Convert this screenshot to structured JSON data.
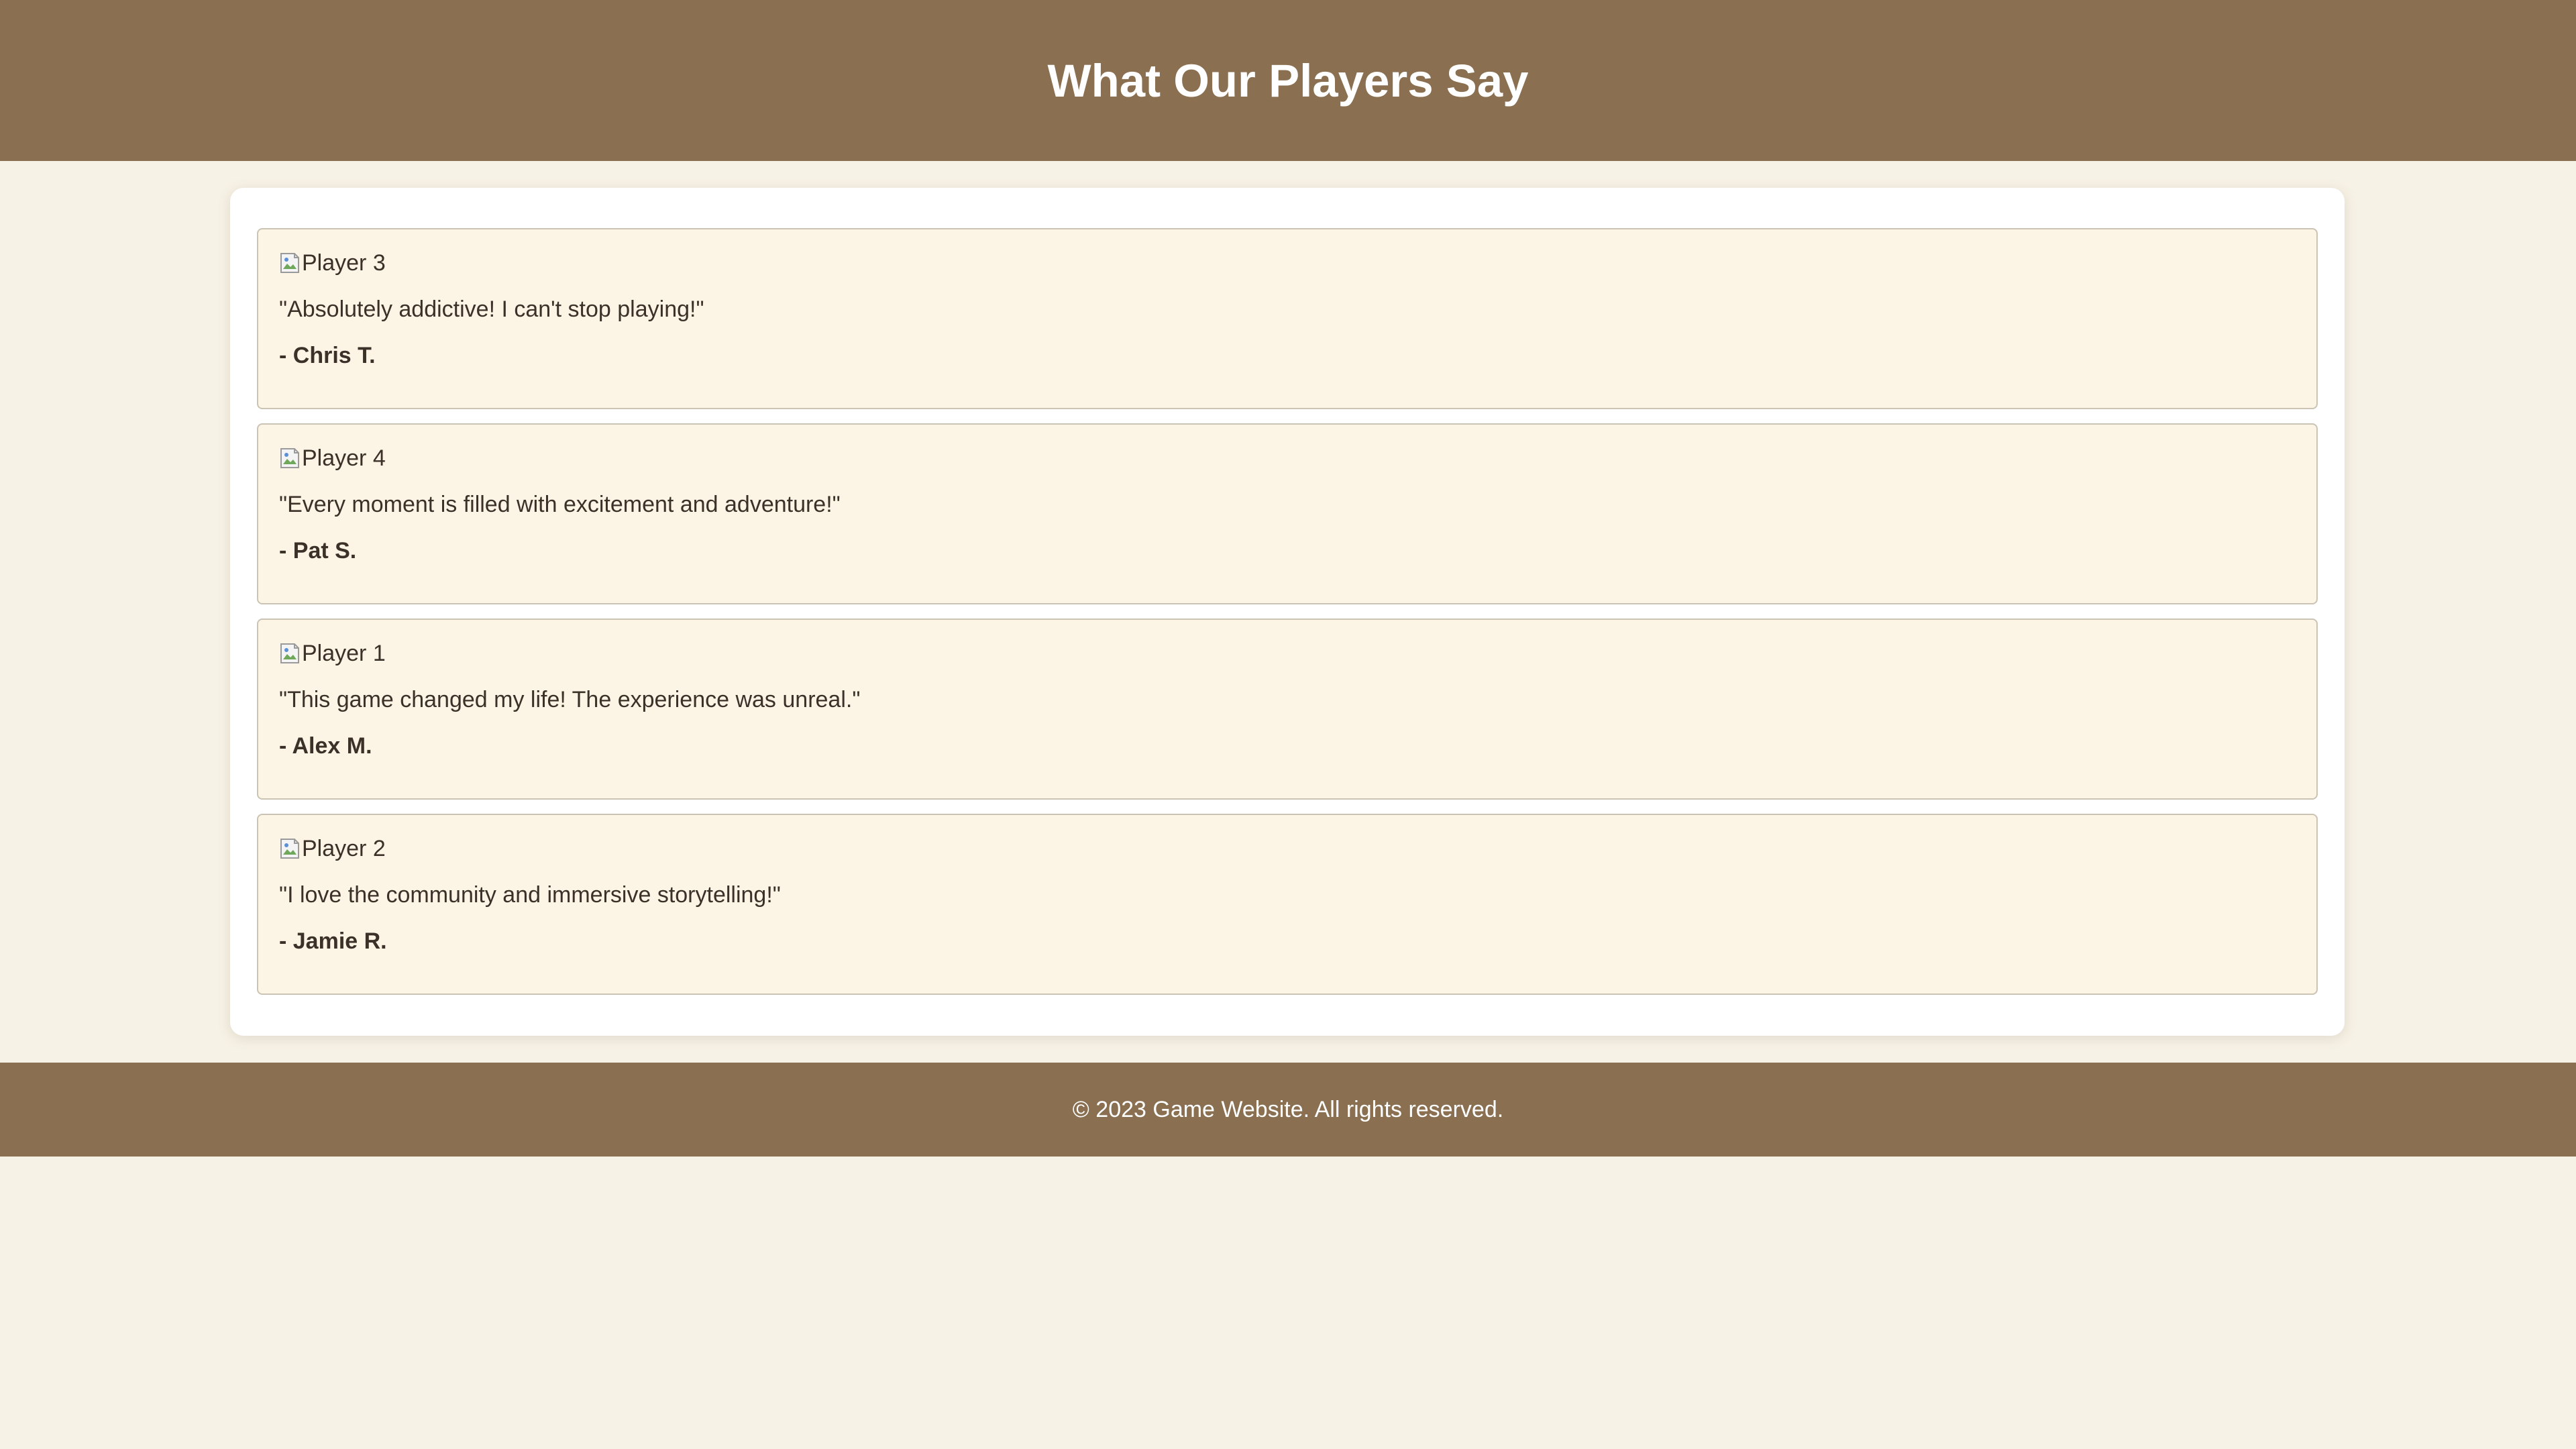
{
  "page_title": "What Our Players Say",
  "testimonials": [
    {
      "image_alt": "Player 3",
      "quote": "\"Absolutely addictive! I can't stop playing!\"",
      "author": "- Chris T."
    },
    {
      "image_alt": "Player 4",
      "quote": "\"Every moment is filled with excitement and adventure!\"",
      "author": "- Pat S."
    },
    {
      "image_alt": "Player 1",
      "quote": "\"This game changed my life! The experience was unreal.\"",
      "author": "- Alex M."
    },
    {
      "image_alt": "Player 2",
      "quote": "\"I love the community and immersive storytelling!\"",
      "author": "- Jamie R."
    }
  ],
  "footer": {
    "text": "© 2023 Game Website. All rights reserved."
  },
  "colors": {
    "header_bg": "#8a6f50",
    "page_bg": "#f7f2e6",
    "card_bg": "#fcf5e5",
    "text": "#3b3128"
  },
  "icons": {
    "avatar": "broken-image-icon"
  }
}
